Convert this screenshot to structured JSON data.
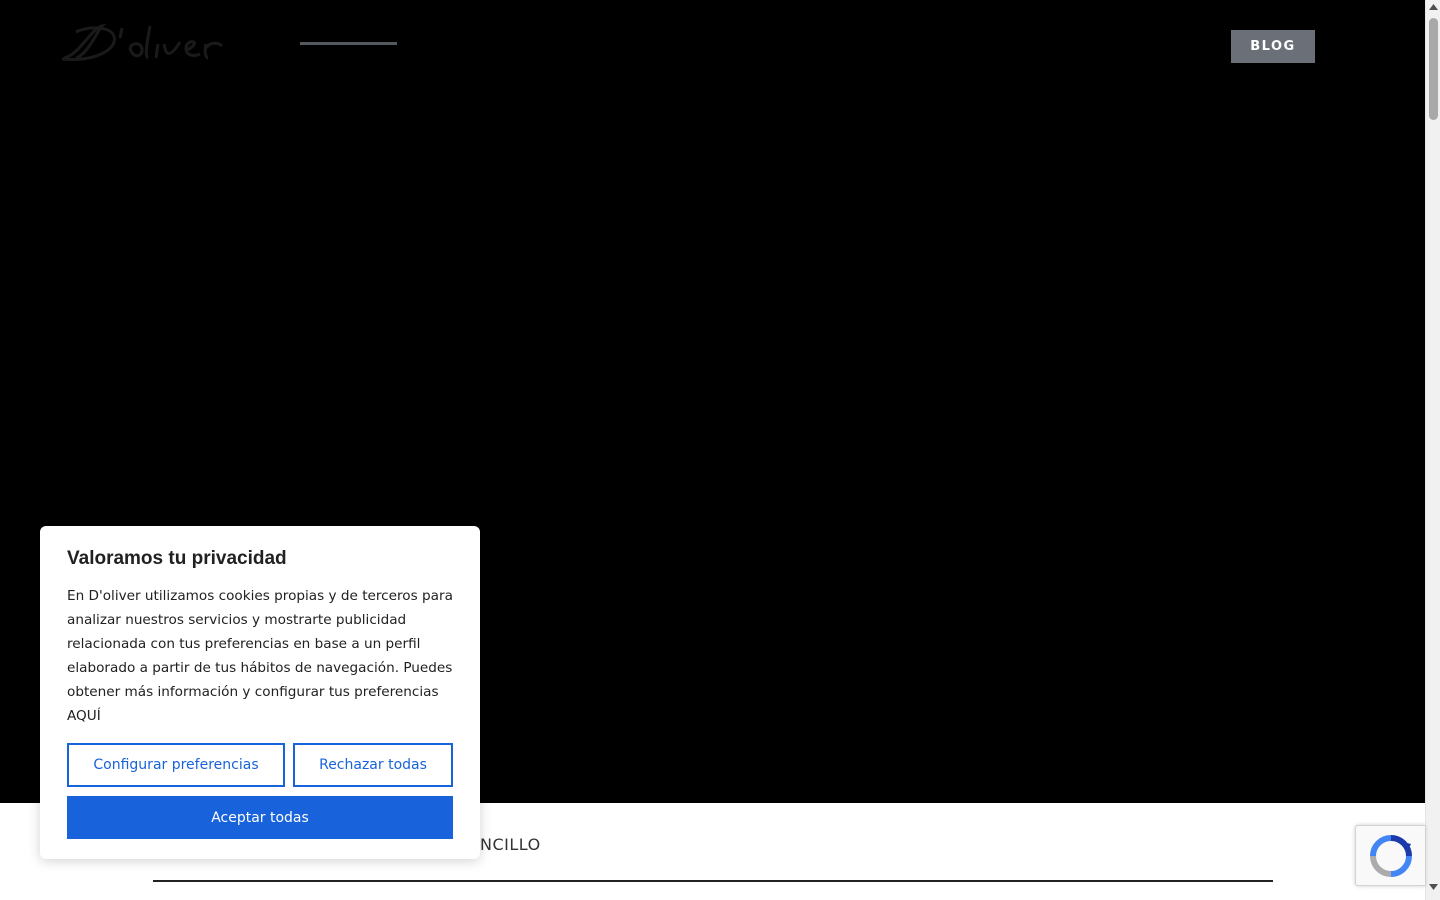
{
  "header": {
    "logo_alt": "D'oliver",
    "blog_label": "BLOG"
  },
  "section": {
    "partial_title": "NCILLO"
  },
  "cookie_banner": {
    "title": "Valoramos tu privacidad",
    "body": "En D'oliver utilizamos cookies propias y de terceros para analizar nuestros servicios y mostrarte publicidad relacionada con tus preferencias en base a un perfil elaborado a partir de tus hábitos de navegación. Puedes obtener más información y configurar tus preferencias AQUÍ",
    "configure_label": "Configurar preferencias",
    "reject_label": "Rechazar todas",
    "accept_label": "Aceptar todas"
  },
  "colors": {
    "hero_bg": "#000000",
    "cookie_accent": "#1863dc",
    "blog_button_bg": "#6a6f78"
  },
  "icons": {
    "recaptcha": "recaptcha-icon",
    "scroll_up": "chevron-up-icon",
    "scroll_down": "chevron-down-icon"
  }
}
